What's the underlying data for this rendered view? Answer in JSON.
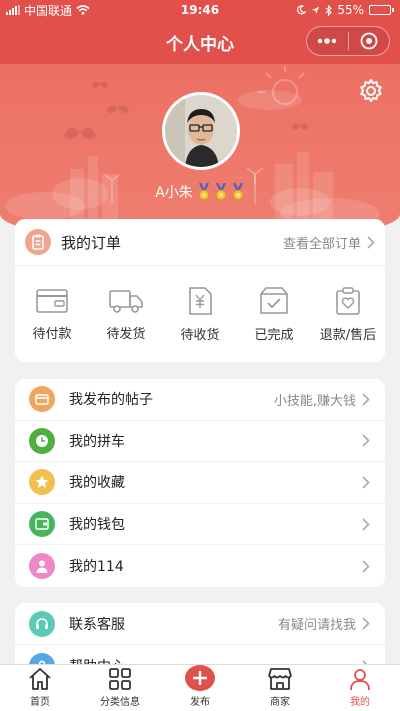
{
  "status_bar": {
    "carrier": "中国联通",
    "time": "19:46",
    "battery": "55%",
    "battery_level": 0.55
  },
  "nav": {
    "title": "个人中心"
  },
  "profile": {
    "username": "A小朱",
    "medal_count": 3
  },
  "orders": {
    "title": "我的订单",
    "view_all": "查看全部订单",
    "items": [
      {
        "label": "待付款",
        "icon": "wallet-icon"
      },
      {
        "label": "待发货",
        "icon": "truck-icon"
      },
      {
        "label": "待收货",
        "icon": "receipt-icon"
      },
      {
        "label": "已完成",
        "icon": "box-check-icon"
      },
      {
        "label": "退款/售后",
        "icon": "clipboard-heart-icon"
      }
    ]
  },
  "menu_group1": [
    {
      "label": "我发布的帖子",
      "hint": "小技能,赚大钱",
      "icon": "card-icon",
      "color": "#f0a560"
    },
    {
      "label": "我的拼车",
      "hint": "",
      "icon": "clock-icon",
      "color": "#4fae3f"
    },
    {
      "label": "我的收藏",
      "hint": "",
      "icon": "star-icon",
      "color": "#f1c14d"
    },
    {
      "label": "我的钱包",
      "hint": "",
      "icon": "wallet-icon",
      "color": "#47b65a"
    },
    {
      "label": "我的114",
      "hint": "",
      "icon": "user-icon",
      "color": "#ee88c6"
    }
  ],
  "menu_group2": [
    {
      "label": "联系客服",
      "hint": "有疑问请找我",
      "icon": "headset-icon",
      "color": "#5ccab5"
    },
    {
      "label": "帮助中心",
      "hint": "",
      "icon": "question-icon",
      "color": "#54a8e6"
    }
  ],
  "tabs": [
    {
      "label": "首页",
      "icon": "home-icon"
    },
    {
      "label": "分类信息",
      "icon": "grid-icon"
    },
    {
      "label": "发布",
      "icon": "plus-icon"
    },
    {
      "label": "商家",
      "icon": "shop-icon"
    },
    {
      "label": "我的",
      "icon": "user-icon",
      "active": true
    }
  ],
  "colors": {
    "brand": "#e2504c",
    "hero": "#ec7064"
  }
}
